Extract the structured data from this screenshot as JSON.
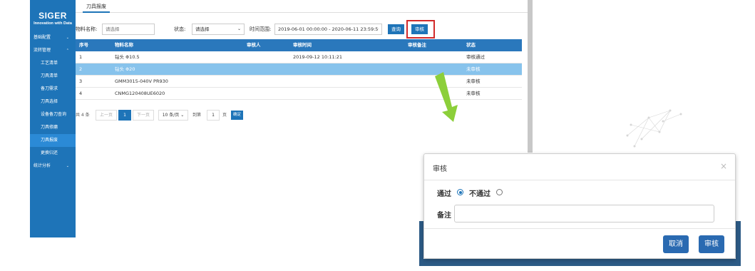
{
  "brand": {
    "title": "SIGER",
    "subtitle": "Innovation with Data"
  },
  "sidebar": {
    "items": [
      {
        "label": "基础配置",
        "arrow": "⌄"
      },
      {
        "label": "流转管理",
        "arrow": "⌃"
      },
      {
        "label": "工艺清单"
      },
      {
        "label": "刀具清单"
      },
      {
        "label": "备刀需求"
      },
      {
        "label": "刀具选择"
      },
      {
        "label": "设备备刀查询"
      },
      {
        "label": "刀具修磨"
      },
      {
        "label": "刀具报废"
      },
      {
        "label": "更换归还"
      },
      {
        "label": "统计分析",
        "arrow": "⌄"
      }
    ]
  },
  "tab": {
    "label": "刀具报废"
  },
  "filters": {
    "material_label": "物料名称:",
    "material_placeholder": "请选择",
    "status_label": "状态:",
    "status_value": "请选择",
    "time_label": "时间范围:",
    "time_value": "2019-06-01 00:00:00 - 2020-06-11 23:59:59",
    "query_button": "查询",
    "audit_button": "审核"
  },
  "table": {
    "headers": [
      "序号",
      "物料名称",
      "审核人",
      "审核时间",
      "审核备注",
      "状态"
    ],
    "rows": [
      [
        "1",
        "钻头 Φ10.5",
        "",
        "2019-09-12 10:11:21",
        "",
        "审核通过"
      ],
      [
        "2",
        "钻头 Φ20",
        "",
        "",
        "",
        "未审核"
      ],
      [
        "3",
        "GMM3015-040V PR930",
        "",
        "",
        "",
        "未审核"
      ],
      [
        "4",
        "CNMG120408UE6020",
        "",
        "",
        "",
        "未审核"
      ]
    ]
  },
  "pagination": {
    "total": "共 4 条",
    "prev": "上一页",
    "current": "1",
    "next": "下一页",
    "per_page": "10 条/页",
    "goto_label": "到第",
    "goto_value": "1",
    "page_unit": "页",
    "confirm": "确定"
  },
  "modal": {
    "title": "审核",
    "close": "×",
    "pass_label": "通过",
    "fail_label": "不通过",
    "remark_label": "备注",
    "cancel_button": "取消",
    "submit_button": "审核"
  },
  "colors": {
    "sidebar": "#1e74b8",
    "table_header": "#2a78bc",
    "selected_row": "#87c3ec",
    "highlight_border": "#d22a2a",
    "arrow": "#8ccf3a"
  }
}
